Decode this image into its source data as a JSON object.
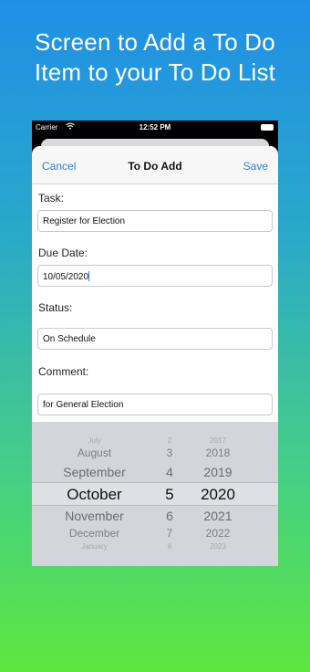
{
  "headline": {
    "line1": "Screen to Add a To Do",
    "line2": "Item to your To Do List"
  },
  "status_bar": {
    "carrier": "Carrier",
    "time": "12:52 PM"
  },
  "nav": {
    "cancel": "Cancel",
    "title": "To Do Add",
    "save": "Save"
  },
  "form": {
    "task_label": "Task:",
    "task_value": "Register for Election",
    "due_label": "Due Date:",
    "due_value": "10/05/2020",
    "status_label": "Status:",
    "status_value": "On Schedule",
    "comment_label": "Comment:",
    "comment_value": "for General Election"
  },
  "date_picker": {
    "rows": [
      {
        "month": "July",
        "day": "2",
        "year": "2017"
      },
      {
        "month": "August",
        "day": "3",
        "year": "2018"
      },
      {
        "month": "September",
        "day": "4",
        "year": "2019"
      },
      {
        "month": "October",
        "day": "5",
        "year": "2020"
      },
      {
        "month": "November",
        "day": "6",
        "year": "2021"
      },
      {
        "month": "December",
        "day": "7",
        "year": "2022"
      },
      {
        "month": "January",
        "day": "8",
        "year": "2023"
      }
    ]
  }
}
